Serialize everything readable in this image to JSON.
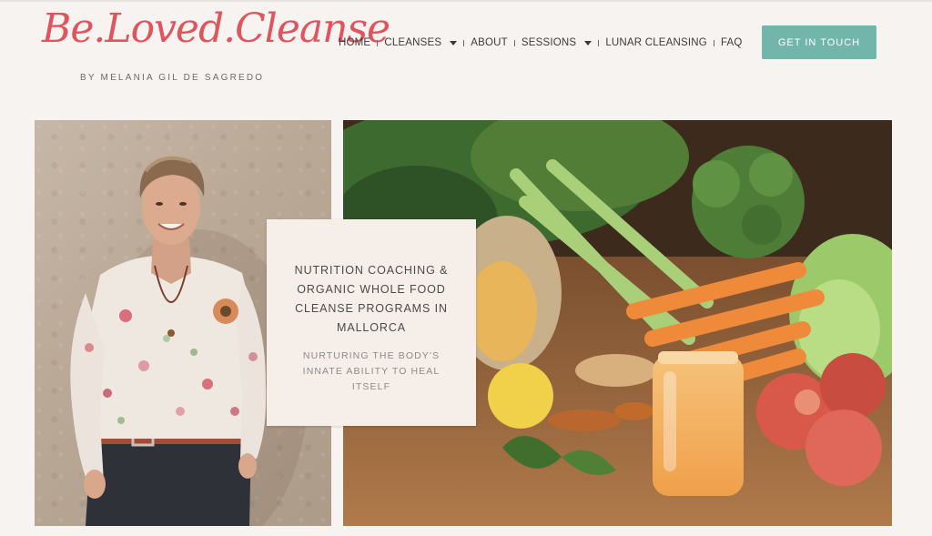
{
  "brand": {
    "logo_text": "Be.Loved.Cleanse",
    "tagline": "BY MELANIA GIL DE SAGREDO",
    "logo_color": "#e0545c"
  },
  "nav": {
    "items": [
      {
        "label": "HOME",
        "dropdown": false
      },
      {
        "label": "CLEANSES",
        "dropdown": true
      },
      {
        "label": "ABOUT",
        "dropdown": false
      },
      {
        "label": "SESSIONS",
        "dropdown": true
      },
      {
        "label": "LUNAR CLEANSING",
        "dropdown": false
      },
      {
        "label": "FAQ",
        "dropdown": false
      }
    ],
    "cta_label": "GET IN TOUCH",
    "cta_color": "#72b5aa"
  },
  "hero": {
    "title": "NUTRITION COACHING & ORGANIC WHOLE FOOD CLEANSE PROGRAMS IN MALLORCA",
    "subtitle": "NURTURING THE BODY'S INNATE ABILITY TO HEAL ITSELF",
    "left_image": "portrait-photo",
    "right_image": "vegetables-juice-photo"
  }
}
